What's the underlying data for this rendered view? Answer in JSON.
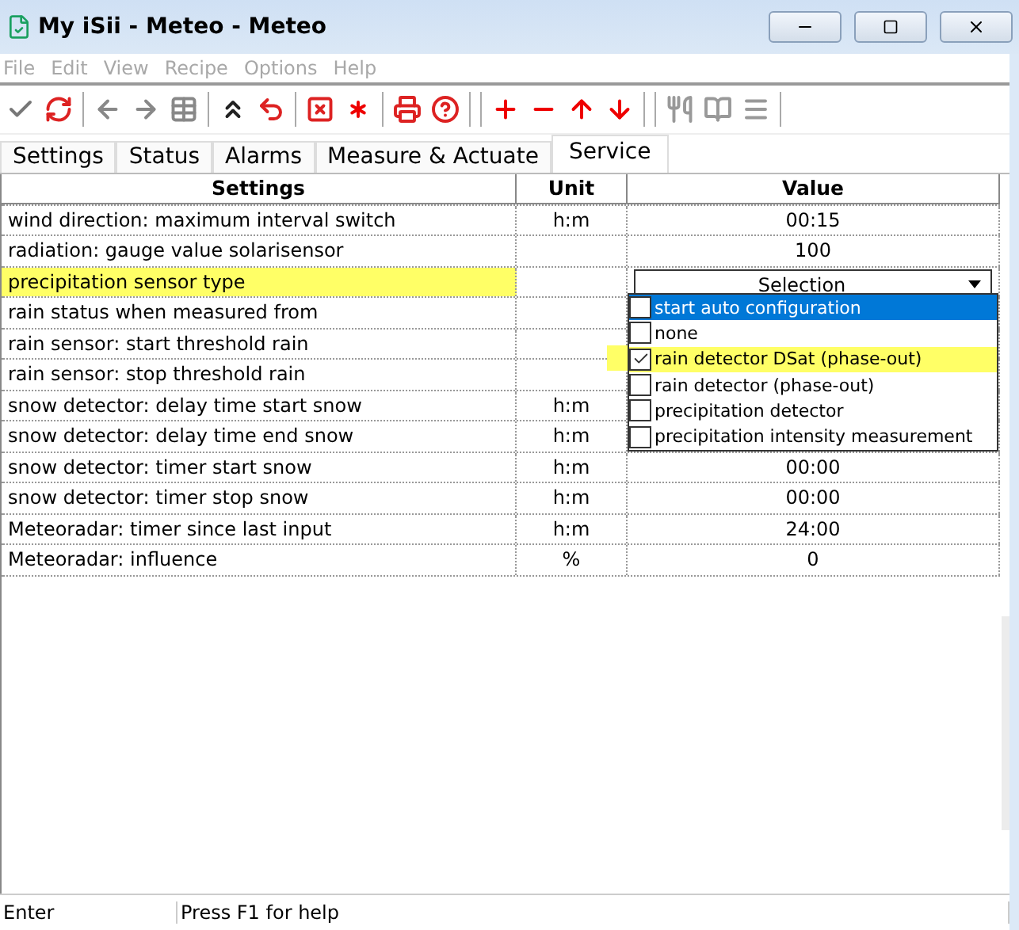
{
  "window": {
    "title": "My iSii - Meteo - Meteo"
  },
  "menu": [
    {
      "label": "File",
      "disabled": true
    },
    {
      "label": "Edit",
      "disabled": true
    },
    {
      "label": "View",
      "disabled": true
    },
    {
      "label": "Recipe",
      "disabled": true
    },
    {
      "label": "Options",
      "disabled": true
    },
    {
      "label": "Help",
      "disabled": true
    }
  ],
  "tabs": [
    {
      "label": "Settings",
      "selected": false
    },
    {
      "label": "Status",
      "selected": false
    },
    {
      "label": "Alarms",
      "selected": false
    },
    {
      "label": "Measure & Actuate",
      "selected": false
    },
    {
      "label": "Service",
      "selected": true
    }
  ],
  "table": {
    "columns": [
      "Settings",
      "Unit",
      "Value"
    ],
    "rows": [
      {
        "setting": "wind direction: maximum interval switch",
        "unit": "h:m",
        "value": "00:15",
        "highlighted": false
      },
      {
        "setting": "radiation: gauge value solarisensor",
        "value": "100",
        "highlighted": false
      },
      {
        "setting": "precipitation sensor type",
        "value": "Selection",
        "kind": "dropdown",
        "highlighted": true
      },
      {
        "setting": "rain status when measured from",
        "highlighted": false
      },
      {
        "setting": "rain sensor: start threshold rain",
        "highlighted": false
      },
      {
        "setting": "rain sensor: stop threshold rain",
        "highlighted": false
      },
      {
        "setting": "snow detector: delay time start snow",
        "unit": "h:m",
        "highlighted": false
      },
      {
        "setting": "snow detector: delay time end snow",
        "unit": "h:m",
        "highlighted": false
      },
      {
        "setting": "snow detector: timer start snow",
        "unit": "h:m",
        "value": "00:00",
        "highlighted": false
      },
      {
        "setting": "snow detector: timer stop snow",
        "unit": "h:m",
        "value": "00:00",
        "highlighted": false
      },
      {
        "setting": "Meteoradar: timer since last input",
        "unit": "h:m",
        "value": "24:00",
        "highlighted": false
      },
      {
        "setting": "Meteoradar: influence",
        "unit": "%",
        "value": "0",
        "highlighted": false
      }
    ]
  },
  "dropdown": {
    "options": [
      {
        "label": "start auto configuration",
        "checked": false,
        "selected": true,
        "highlighted": false
      },
      {
        "label": "none",
        "checked": false,
        "selected": false,
        "highlighted": false
      },
      {
        "label": "rain detector DSat (phase-out)",
        "checked": true,
        "selected": false,
        "highlighted": true
      },
      {
        "label": "rain detector (phase-out)",
        "checked": false,
        "selected": false,
        "highlighted": false
      },
      {
        "label": "precipitation detector",
        "checked": false,
        "selected": false,
        "highlighted": false
      },
      {
        "label": "precipitation intensity measurement",
        "checked": false,
        "selected": false,
        "highlighted": false
      }
    ]
  },
  "status_bar": [
    "Enter",
    "Press F1 for help"
  ]
}
